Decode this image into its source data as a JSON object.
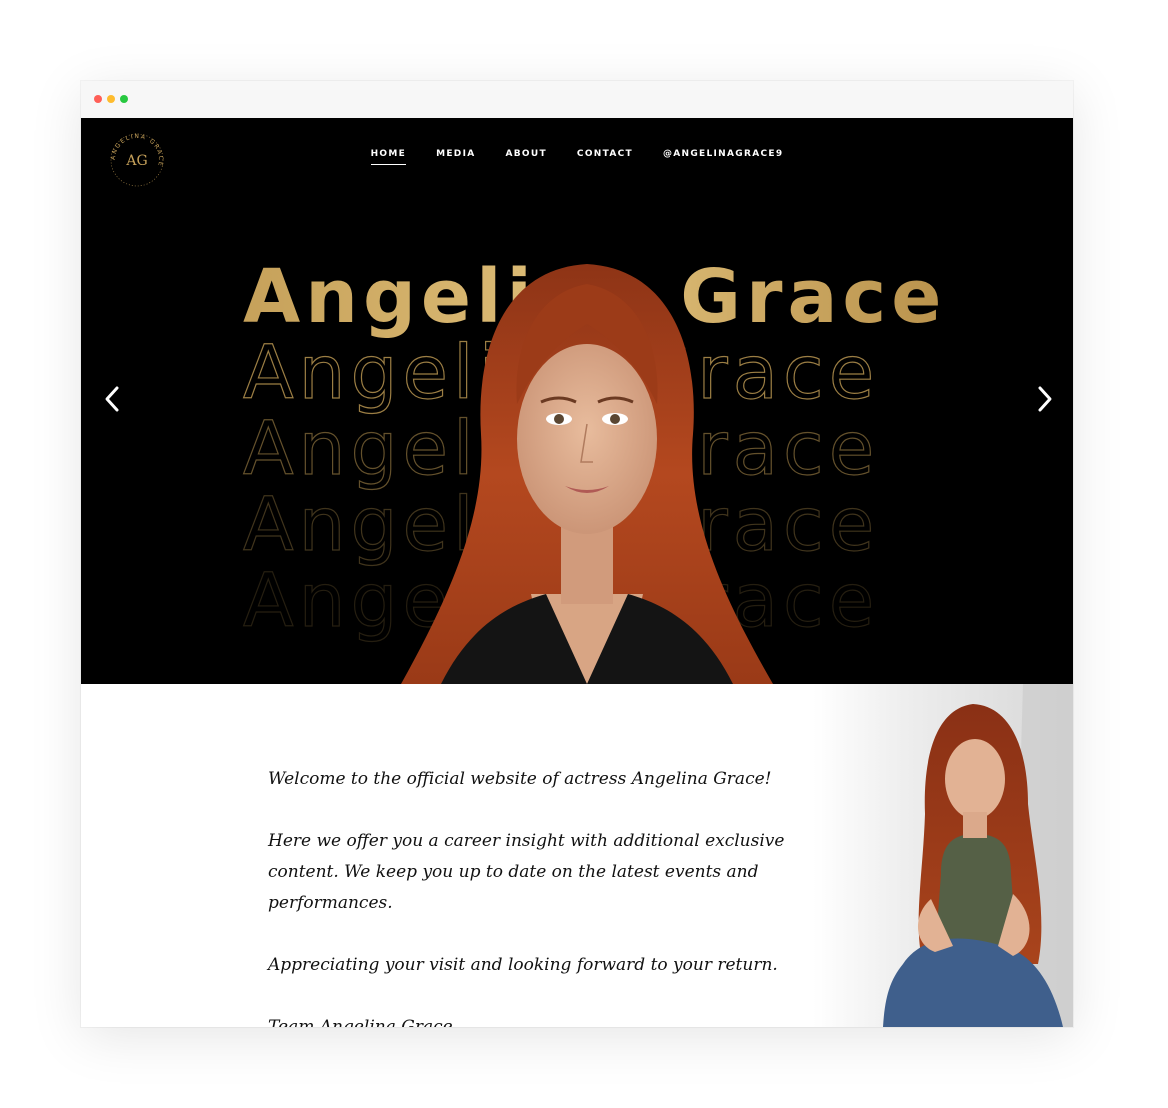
{
  "nav": {
    "items": [
      {
        "label": "HOME",
        "active": true
      },
      {
        "label": "MEDIA",
        "active": false
      },
      {
        "label": "ABOUT",
        "active": false
      },
      {
        "label": "CONTACT",
        "active": false
      },
      {
        "label": "@ANGELINAGRACE9",
        "active": false
      }
    ]
  },
  "logo": {
    "monogram": "AG",
    "ring_text": "ANGELINA GRACE"
  },
  "hero": {
    "title": "Angelina Grace",
    "echo_text": "Angelina Grace",
    "prev_icon": "chevron-left-icon",
    "next_icon": "chevron-right-icon"
  },
  "content": {
    "paragraphs": [
      "Welcome to the official website of actress Angelina Grace!",
      "Here we offer you a career insight with additional exclusive content. We keep you up to date on the latest events and performances.",
      "Appreciating your visit and looking forward to your return.",
      "Team Angelina Grace"
    ]
  },
  "colors": {
    "hero_bg": "#000000",
    "gold": "#c6a15a",
    "hair": "#a8401c"
  }
}
